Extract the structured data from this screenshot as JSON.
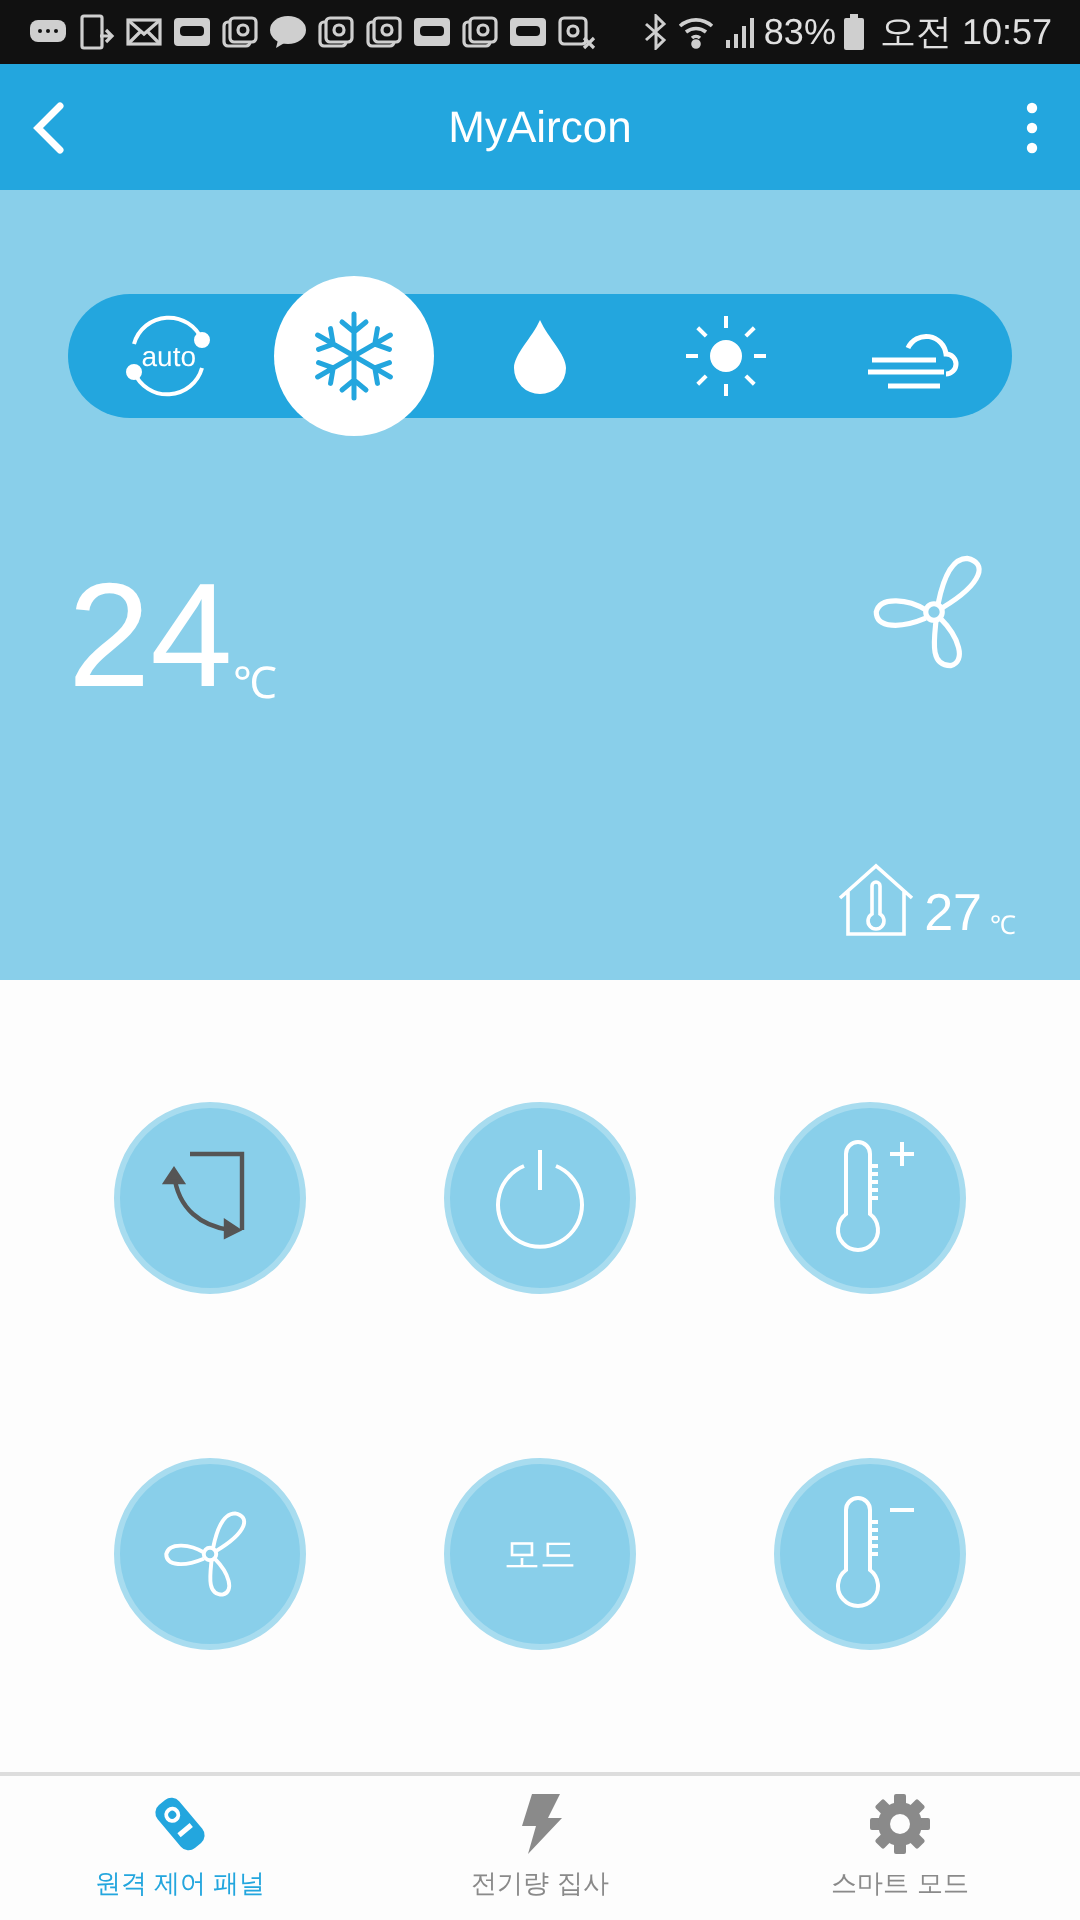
{
  "status_bar": {
    "notifications": [
      {
        "kind": "chat"
      },
      {
        "kind": "device"
      },
      {
        "kind": "mail"
      },
      {
        "kind": "band"
      },
      {
        "kind": "at"
      },
      {
        "kind": "talk"
      },
      {
        "kind": "at"
      },
      {
        "kind": "at"
      },
      {
        "kind": "band"
      },
      {
        "kind": "at"
      },
      {
        "kind": "band"
      },
      {
        "kind": "at_off"
      }
    ],
    "battery_percent": "83%",
    "time": "오전 10:57"
  },
  "header": {
    "title": "MyAircon"
  },
  "modes": [
    {
      "kind": "auto",
      "label": "auto",
      "selected": false
    },
    {
      "kind": "cool",
      "selected": true
    },
    {
      "kind": "dry",
      "selected": false
    },
    {
      "kind": "heat",
      "selected": false
    },
    {
      "kind": "fan",
      "selected": false
    }
  ],
  "set_temperature": {
    "value": "24",
    "unit": "℃"
  },
  "room_temperature": {
    "value": "27",
    "unit": "℃"
  },
  "controls": [
    {
      "kind": "swing"
    },
    {
      "kind": "power"
    },
    {
      "kind": "temp_up"
    },
    {
      "kind": "fan"
    },
    {
      "kind": "mode",
      "label": "모드"
    },
    {
      "kind": "temp_down"
    }
  ],
  "tabs": [
    {
      "kind": "remote",
      "label": "원격 제어 패널",
      "selected": true
    },
    {
      "kind": "energy",
      "label": "전기량 집사",
      "selected": false
    },
    {
      "kind": "settings",
      "label": "스마트 모드",
      "selected": false
    }
  ]
}
